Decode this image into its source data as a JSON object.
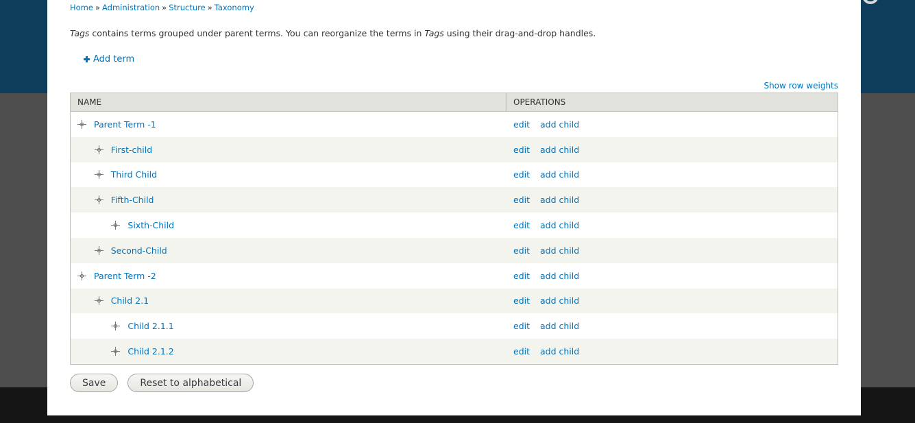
{
  "breadcrumb": {
    "items": [
      "Home",
      "Administration",
      "Structure",
      "Taxonomy"
    ],
    "separator": "»"
  },
  "help": {
    "vocab": "Tags",
    "text_a": " contains terms grouped under parent terms. You can reorganize the terms in ",
    "text_b": " using their drag-and-drop handles."
  },
  "add_term": {
    "label": "Add term",
    "icon": "plus-icon"
  },
  "show_row_weights": "Show row weights",
  "table": {
    "headers": {
      "name": "NAME",
      "operations": "OPERATIONS"
    },
    "rows": [
      {
        "name": "Parent Term -1",
        "depth": 0
      },
      {
        "name": "First-child",
        "depth": 1
      },
      {
        "name": "Third Child",
        "depth": 1
      },
      {
        "name": "Fifth-Child",
        "depth": 1
      },
      {
        "name": "Sixth-Child",
        "depth": 2
      },
      {
        "name": "Second-Child",
        "depth": 1
      },
      {
        "name": "Parent Term -2",
        "depth": 0
      },
      {
        "name": "Child 2.1",
        "depth": 1
      },
      {
        "name": "Child 2.1.1",
        "depth": 2
      },
      {
        "name": "Child 2.1.2",
        "depth": 2
      }
    ],
    "ops": {
      "edit": "edit",
      "add_child": "add child"
    }
  },
  "actions": {
    "save": "Save",
    "reset": "Reset to alphabetical"
  },
  "colors": {
    "link": "#0074bd",
    "header_bg": "#0e3d5b",
    "table_head": "#e1e2dc",
    "row_alt": "#f3f4ee"
  }
}
